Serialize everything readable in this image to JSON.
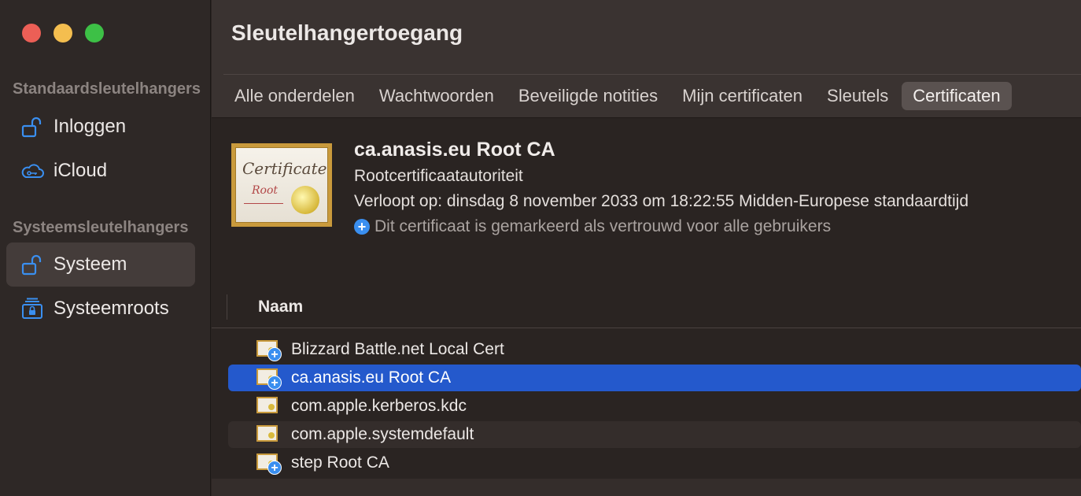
{
  "sidebar": {
    "section_standard": "Standaardsleutelhangers",
    "section_system": "Systeemsleutelhangers",
    "items": [
      {
        "label": "Inloggen",
        "icon": "unlocked-padlock-icon"
      },
      {
        "label": "iCloud",
        "icon": "icloud-key-icon"
      },
      {
        "label": "Systeem",
        "icon": "unlocked-padlock-icon",
        "selected": true
      },
      {
        "label": "Systeemroots",
        "icon": "locked-cabinet-icon"
      }
    ]
  },
  "header": {
    "title": "Sleutelhangertoegang",
    "tabs": [
      {
        "label": "Alle onderdelen"
      },
      {
        "label": "Wachtwoorden"
      },
      {
        "label": "Beveiligde notities"
      },
      {
        "label": "Mijn certificaten"
      },
      {
        "label": "Sleutels"
      },
      {
        "label": "Certificaten",
        "active": true
      }
    ]
  },
  "detail": {
    "name": "ca.anasis.eu Root CA",
    "type": "Rootcertificaatautoriteit",
    "expires": "Verloopt op: dinsdag 8 november 2033 om 18:22:55 Midden-Europese standaardtijd",
    "trust": "Dit certificaat is gemarkeerd als vertrouwd voor alle gebruikers",
    "cert_text1": "Certificate",
    "cert_text2": "Root"
  },
  "list": {
    "column": "Naam",
    "rows": [
      {
        "name": "Blizzard Battle.net Local Cert",
        "trusted": true
      },
      {
        "name": "ca.anasis.eu Root CA",
        "trusted": true,
        "selected": true
      },
      {
        "name": "com.apple.kerberos.kdc",
        "trusted": false
      },
      {
        "name": "com.apple.systemdefault",
        "trusted": false
      },
      {
        "name": "step Root CA",
        "trusted": true
      }
    ]
  },
  "colors": {
    "accent": "#2459cc",
    "icon_blue": "#3a8ff0"
  }
}
